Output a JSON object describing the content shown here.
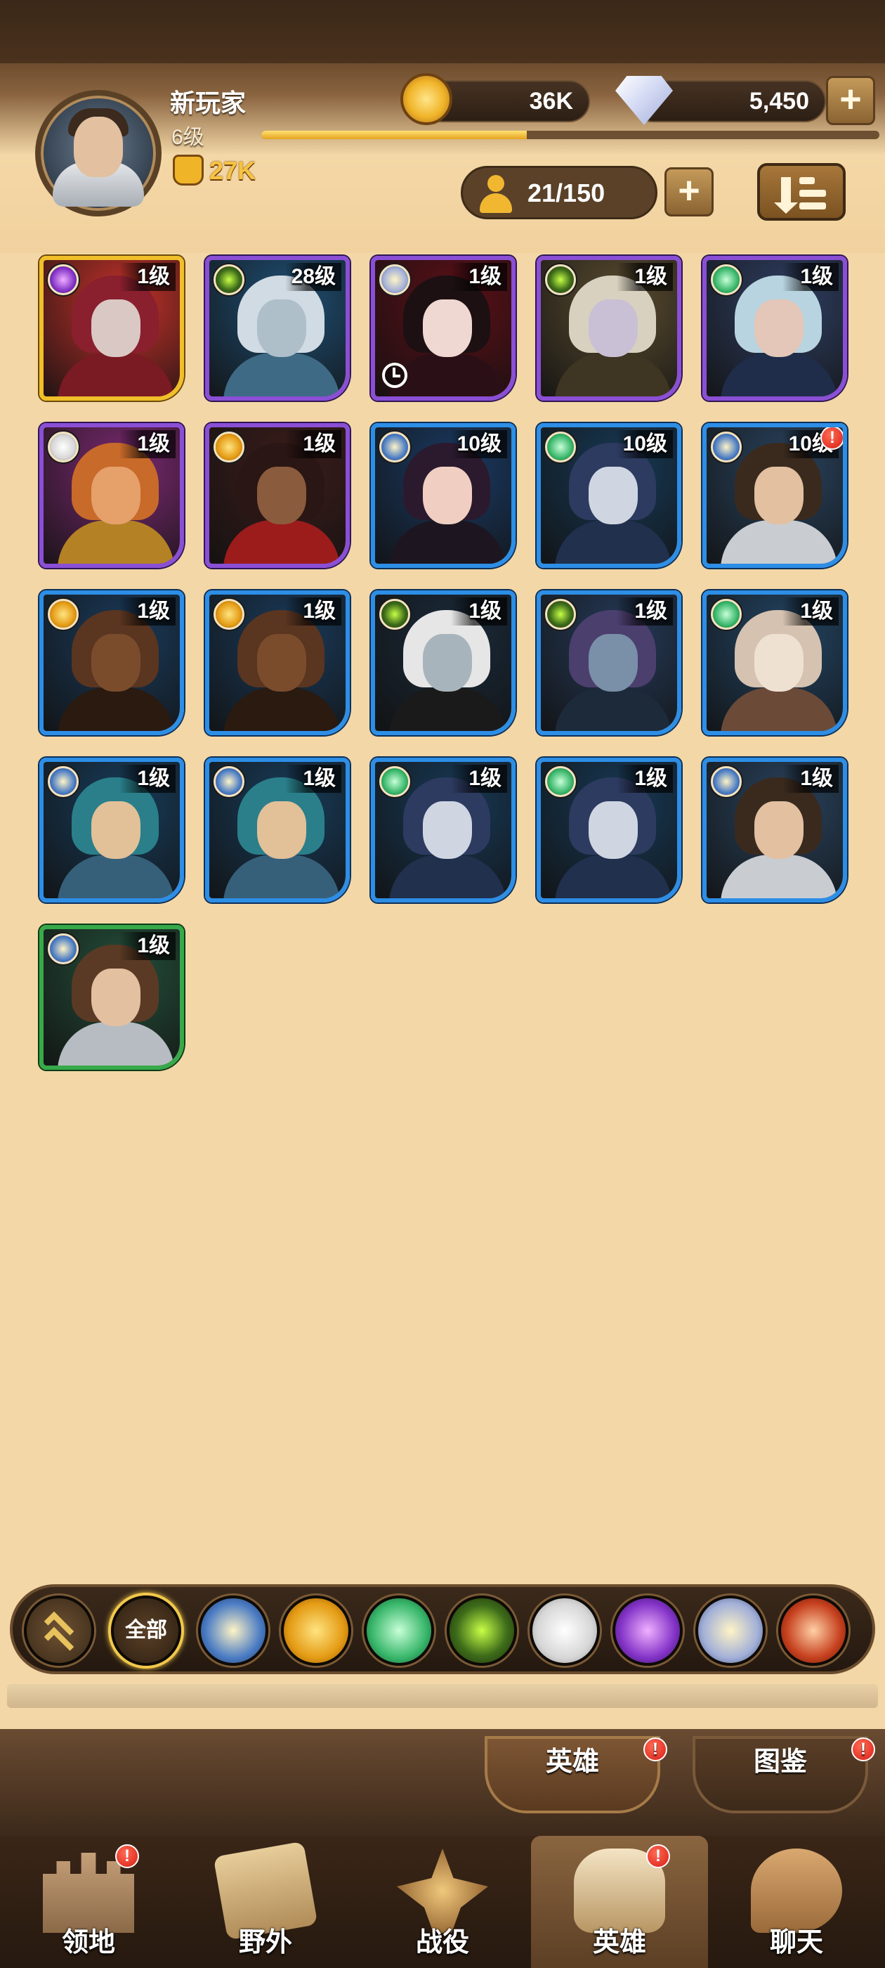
{
  "player": {
    "name": "新玩家",
    "level": "6级",
    "exp_progress": 0.43,
    "power": "27K"
  },
  "currency": {
    "gold": "36K",
    "gems": "5,450"
  },
  "hero_count": "21/150",
  "heroes": [
    {
      "level": "1级",
      "rarity": "gold",
      "faction": "void-icon",
      "palette": "crimson"
    },
    {
      "level": "28级",
      "rarity": "purple",
      "faction": "eye-icon",
      "palette": "frost"
    },
    {
      "level": "1级",
      "rarity": "purple",
      "faction": "holy-icon",
      "palette": "vampire",
      "timer": true
    },
    {
      "level": "1级",
      "rarity": "purple",
      "faction": "eye-icon",
      "palette": "goldcrown"
    },
    {
      "level": "1级",
      "rarity": "purple",
      "faction": "nature-icon",
      "palette": "silverelf"
    },
    {
      "level": "1级",
      "rarity": "purple",
      "faction": "light-icon",
      "palette": "monkey"
    },
    {
      "level": "1级",
      "rarity": "purple",
      "faction": "tech-icon",
      "palette": "beast"
    },
    {
      "level": "10级",
      "rarity": "blue",
      "faction": "star-icon",
      "palette": "witch"
    },
    {
      "level": "10级",
      "rarity": "blue",
      "faction": "nature-icon",
      "palette": "hood"
    },
    {
      "level": "10级",
      "rarity": "blue",
      "faction": "star-icon",
      "palette": "knight",
      "alert": "!"
    },
    {
      "level": "1级",
      "rarity": "blue",
      "faction": "tech-icon",
      "palette": "wolf"
    },
    {
      "level": "1级",
      "rarity": "blue",
      "faction": "tech-icon",
      "palette": "wolf"
    },
    {
      "level": "1级",
      "rarity": "blue",
      "faction": "eye-icon",
      "palette": "ghost"
    },
    {
      "level": "1级",
      "rarity": "blue",
      "faction": "eye-icon",
      "palette": "goblin"
    },
    {
      "level": "1级",
      "rarity": "blue",
      "faction": "nature-icon",
      "palette": "ram"
    },
    {
      "level": "1级",
      "rarity": "blue",
      "faction": "star-icon",
      "palette": "pirate"
    },
    {
      "level": "1级",
      "rarity": "blue",
      "faction": "star-icon",
      "palette": "pirate"
    },
    {
      "level": "1级",
      "rarity": "blue",
      "faction": "nature-icon",
      "palette": "hood"
    },
    {
      "level": "1级",
      "rarity": "blue",
      "faction": "nature-icon",
      "palette": "hood"
    },
    {
      "level": "1级",
      "rarity": "blue",
      "faction": "star-icon",
      "palette": "knight"
    },
    {
      "level": "1级",
      "rarity": "green",
      "faction": "star-icon",
      "palette": "soldier"
    }
  ],
  "filters": {
    "all_label": "全部",
    "items": [
      "star-icon",
      "tech-icon",
      "nature-icon",
      "eye-icon",
      "light-icon",
      "void-icon",
      "holy-icon",
      "fire-icon"
    ]
  },
  "sub_tabs": {
    "heroes": "英雄",
    "handbook": "图鉴",
    "alert": "!"
  },
  "nav": [
    {
      "label": "领地",
      "icon": "castle-icon",
      "alert": "!"
    },
    {
      "label": "野外",
      "icon": "scroll-icon"
    },
    {
      "label": "战役",
      "icon": "sword-icon"
    },
    {
      "label": "英雄",
      "icon": "armor-icon",
      "alert": "!"
    },
    {
      "label": "聊天",
      "icon": "chat-icon"
    }
  ],
  "colors": {
    "background": "#f3d7a7",
    "gold_rarity": "#f0bf2a",
    "purple_rarity": "#8a4fd5",
    "blue_rarity": "#2d8ee6",
    "green_rarity": "#37a94a",
    "alert": "#d81e14"
  }
}
